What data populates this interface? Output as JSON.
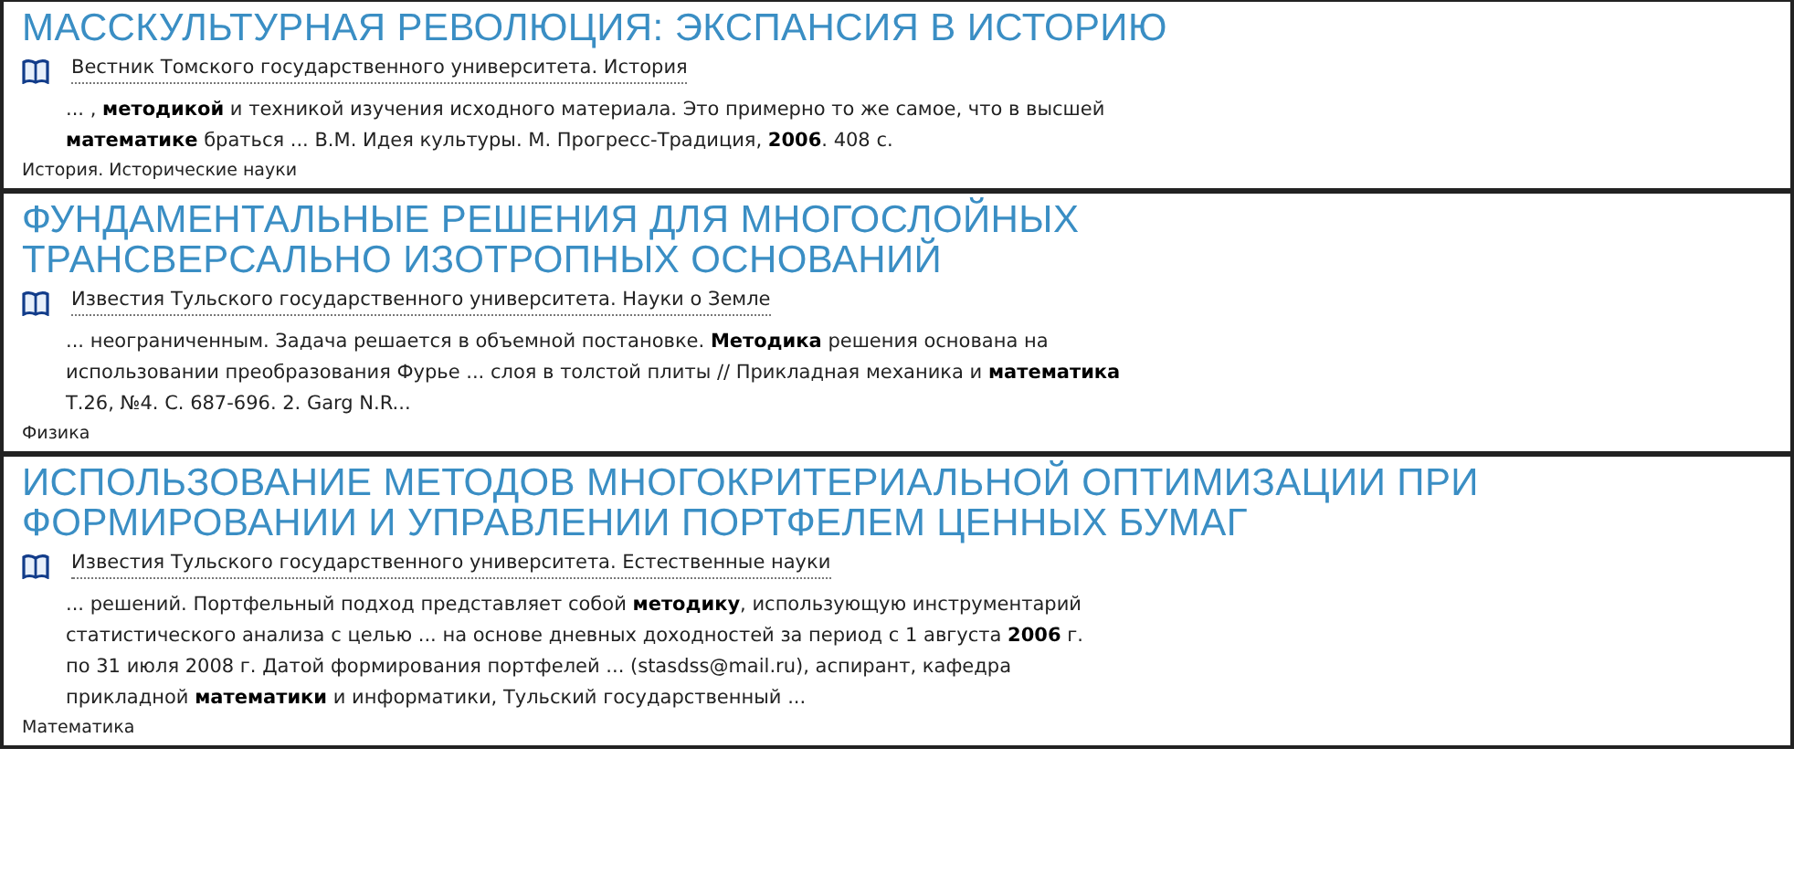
{
  "results": [
    {
      "title_lines": [
        "МАССКУЛЬТУРНАЯ РЕВОЛЮЦИЯ: ЭКСПАНСИЯ В ИСТОРИЮ"
      ],
      "source": "Вестник Томского государственного университета. История",
      "snippet_lines": [
        "... , **методикой** и техникой изучения исходного материала. Это примерно то же самое, что в высшей",
        "**математике** браться ... В.М. Идея культуры. М. Прогресс-Традиция, **2006**. 408 с."
      ],
      "category": "История. Исторические науки"
    },
    {
      "title_lines": [
        "ФУНДАМЕНТАЛЬНЫЕ РЕШЕНИЯ ДЛЯ МНОГОСЛОЙНЫХ",
        "ТРАНСВЕРСАЛЬНО ИЗОТРОПНЫХ ОСНОВАНИЙ"
      ],
      "source": "Известия Тульского государственного университета. Науки о Земле",
      "snippet_lines": [
        "... неограниченным. Задача решается в объемной постановке. **Методика** решения основана на",
        "использовании преобразования Фурье ... слоя в толстой плиты // Прикладная механика и **математика**",
        "Т.26, №4. С. 687-696. 2. Garg N.R..."
      ],
      "category": "Физика"
    },
    {
      "title_lines": [
        "ИСПОЛЬЗОВАНИЕ МЕТОДОВ МНОГОКРИТЕРИАЛЬНОЙ ОПТИМИЗАЦИИ ПРИ",
        "ФОРМИРОВАНИИ И УПРАВЛЕНИИ ПОРТФЕЛЕМ ЦЕННЫХ БУМАГ"
      ],
      "source": "Известия Тульского государственного университета. Естественные науки",
      "snippet_lines": [
        "... решений. Портфельный подход представляет собой **методику**, использующую инструментарий",
        "статистического анализа с целью ... на основе дневных доходностей за период с 1 августа **2006** г.",
        "по 31 июля 2008 г. Датой формирования портфелей ... (stasdss@mail.ru), аспирант, кафедра",
        "прикладной **математики** и информатики, Тульский государственный ..."
      ],
      "category": "Математика"
    }
  ]
}
